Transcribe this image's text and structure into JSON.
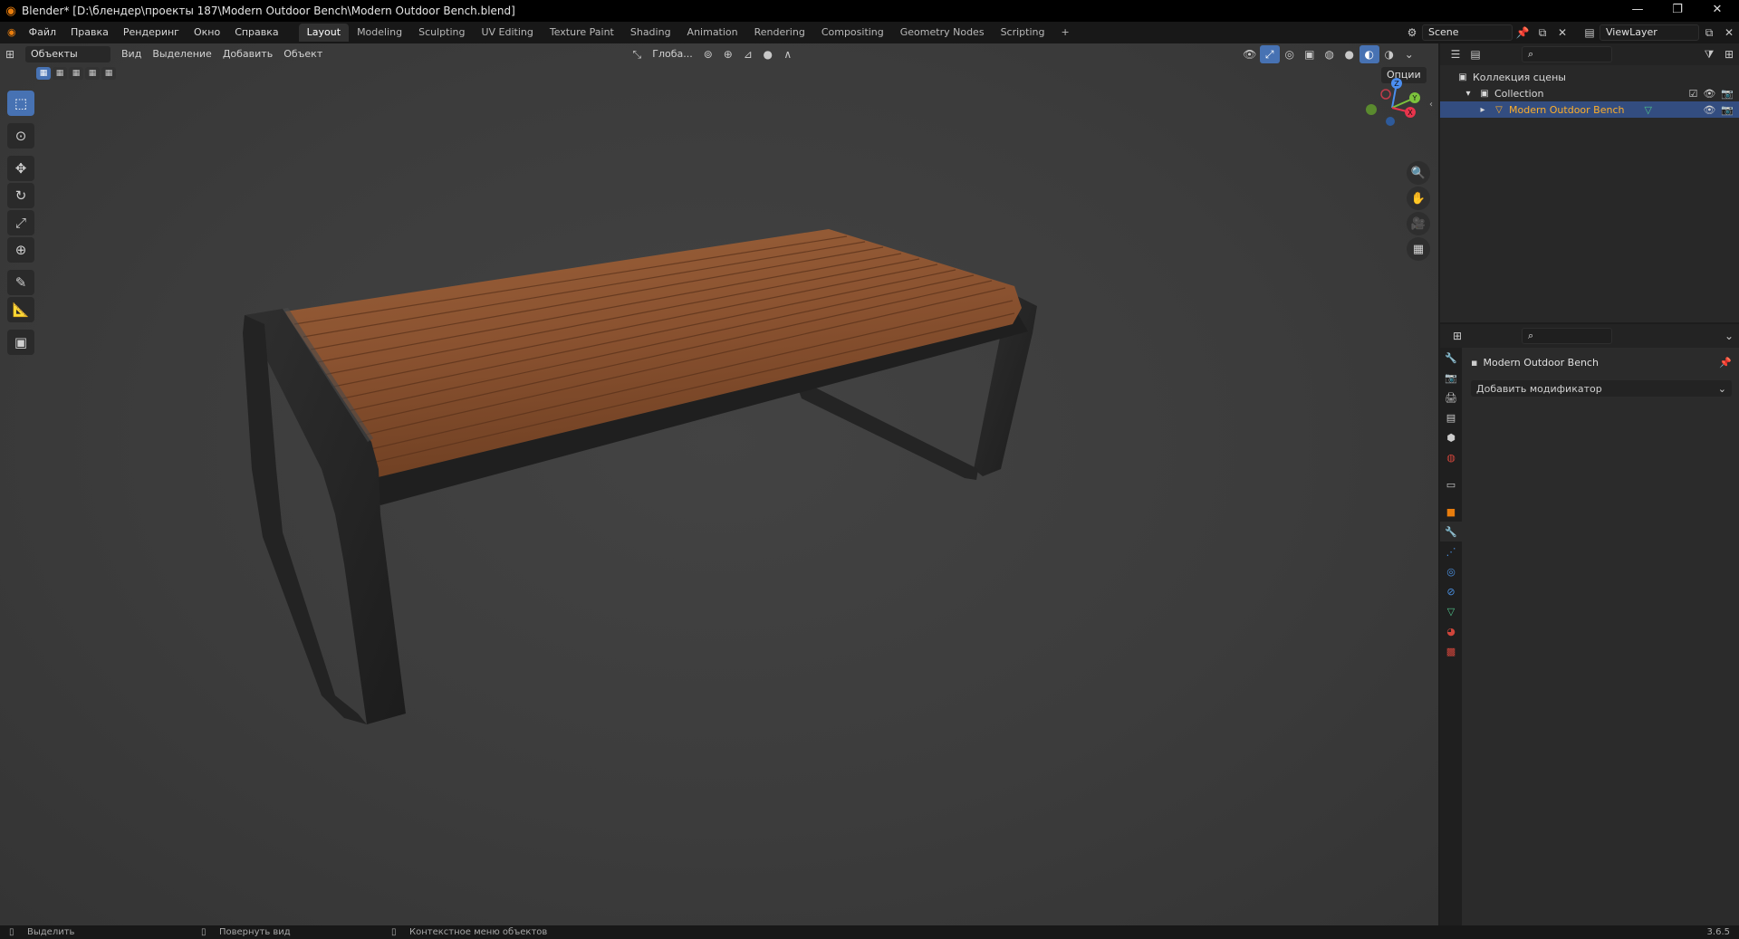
{
  "window": {
    "title": "Blender* [D:\\блендер\\проекты 187\\Modern Outdoor Bench\\Modern Outdoor Bench.blend]",
    "controls": [
      "—",
      "❐",
      "✕"
    ]
  },
  "menu": [
    "Файл",
    "Правка",
    "Рендеринг",
    "Окно",
    "Справка"
  ],
  "workspaces": {
    "tabs": [
      "Layout",
      "Modeling",
      "Sculpting",
      "UV Editing",
      "Texture Paint",
      "Shading",
      "Animation",
      "Rendering",
      "Compositing",
      "Geometry Nodes",
      "Scripting"
    ],
    "active": "Layout",
    "add": "+"
  },
  "scene": {
    "label": "Scene"
  },
  "view_layer": {
    "label": "ViewLayer"
  },
  "viewport": {
    "mode": "Объекты",
    "menus": [
      "Вид",
      "Выделение",
      "Добавить",
      "Объект"
    ],
    "orientation": "Глоба...",
    "options": "Опции",
    "tools": [
      "select-box",
      "cursor",
      "move",
      "rotate",
      "scale",
      "transform",
      "annotate",
      "measure",
      "add-cube"
    ]
  },
  "gizmo": {
    "x": "X",
    "y": "Y",
    "z": "Z"
  },
  "outliner": {
    "root": "Коллекция сцены",
    "collection": "Collection",
    "object": "Modern Outdoor Bench"
  },
  "properties": {
    "object_name": "Modern Outdoor Bench",
    "add_modifier": "Добавить модификатор"
  },
  "status": {
    "select": "Выделить",
    "rotate_view": "Повернуть вид",
    "context_menu": "Контекстное меню объектов",
    "version": "3.6.5"
  },
  "colors": {
    "accent": "#4772b3",
    "active_object": "#ffaf29",
    "wood": "#8a5230",
    "metal": "#262626"
  }
}
